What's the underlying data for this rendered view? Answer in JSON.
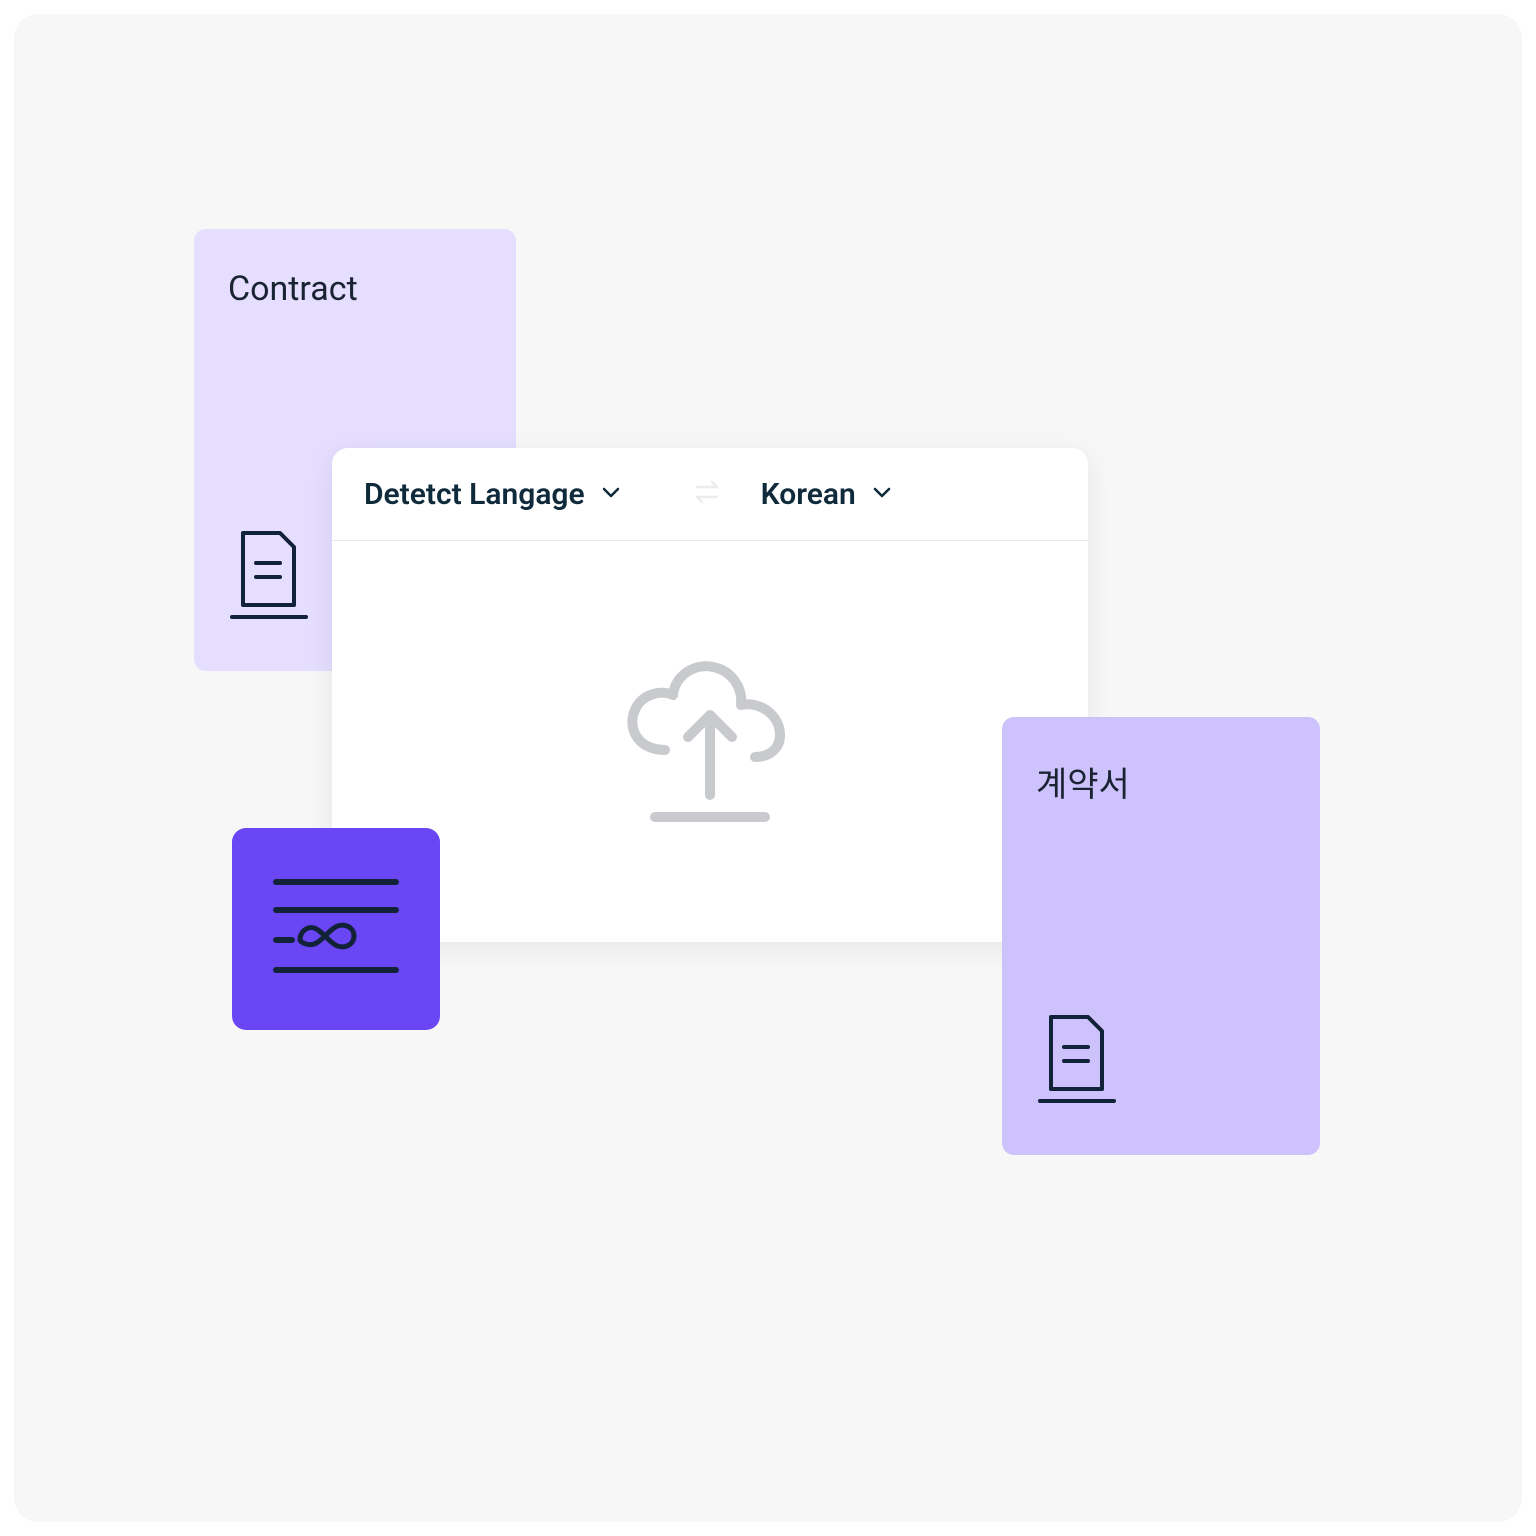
{
  "cards": {
    "source": {
      "title": "Contract"
    },
    "target": {
      "title": "계약서"
    }
  },
  "translator": {
    "source_lang": "Detetct Langage",
    "target_lang": "Korean"
  },
  "colors": {
    "bg": "#f7f7f8",
    "card_light": "#e5deff",
    "card_medium": "#cdc2fb",
    "tile": "#6b46f5",
    "text_dark": "#0e2a3b",
    "icon_gray": "#c8cacd"
  }
}
